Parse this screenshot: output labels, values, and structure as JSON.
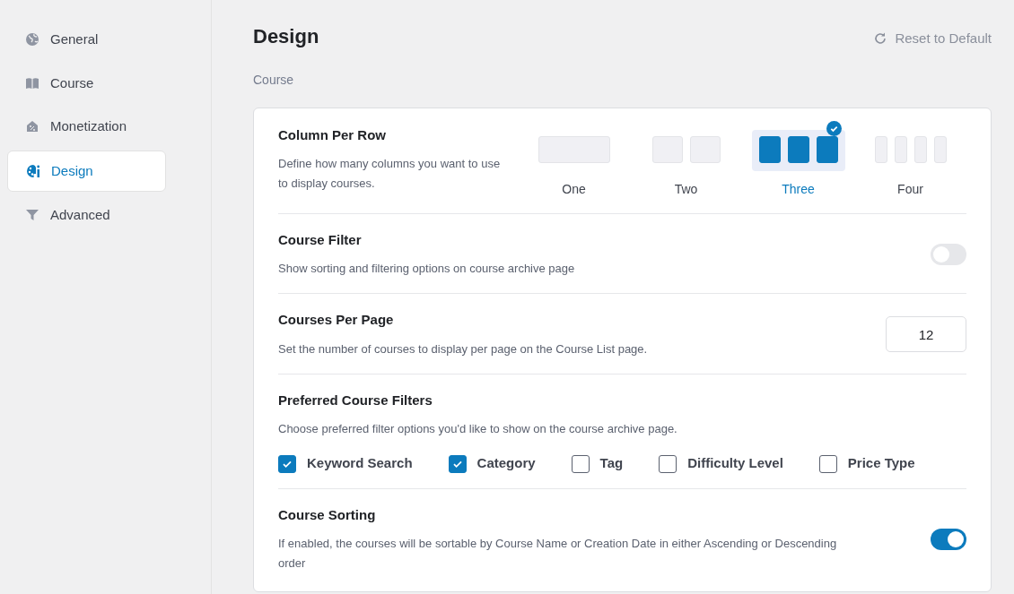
{
  "sidebar": {
    "items": [
      {
        "label": "General",
        "selected": false
      },
      {
        "label": "Course",
        "selected": false
      },
      {
        "label": "Monetization",
        "selected": false
      },
      {
        "label": "Design",
        "selected": true
      },
      {
        "label": "Advanced",
        "selected": false
      }
    ]
  },
  "header": {
    "title": "Design",
    "reset_button": "Reset to Default"
  },
  "section_label": "Course",
  "settings": [
    {
      "kind": "columns",
      "title": "Column Per Row",
      "description": "Define how many columns you want to use to display courses.",
      "options": [
        {
          "label": "One",
          "selected": false
        },
        {
          "label": "Two",
          "selected": false
        },
        {
          "label": "Three",
          "selected": true
        },
        {
          "label": "Four",
          "selected": false
        }
      ]
    },
    {
      "kind": "toggle",
      "title": "Course Filter",
      "description": "Show sorting and filtering options on course archive page",
      "on": false
    },
    {
      "kind": "number",
      "title": "Courses Per Page",
      "description": "Set the number of courses to display per page on the Course List page.",
      "value": "12"
    },
    {
      "kind": "checkboxes",
      "title": "Preferred Course Filters",
      "description": "Choose preferred filter options you'd like to show on the course archive page.",
      "items": [
        {
          "label": "Keyword Search",
          "checked": true
        },
        {
          "label": "Category",
          "checked": true
        },
        {
          "label": "Tag",
          "checked": false
        },
        {
          "label": "Difficulty Level",
          "checked": false
        },
        {
          "label": "Price Type",
          "checked": false
        }
      ]
    },
    {
      "kind": "toggle",
      "title": "Course Sorting",
      "description": "If enabled, the courses will be sortable by Course Name or Creation Date in either Ascending or Descending order",
      "on": true
    }
  ]
}
